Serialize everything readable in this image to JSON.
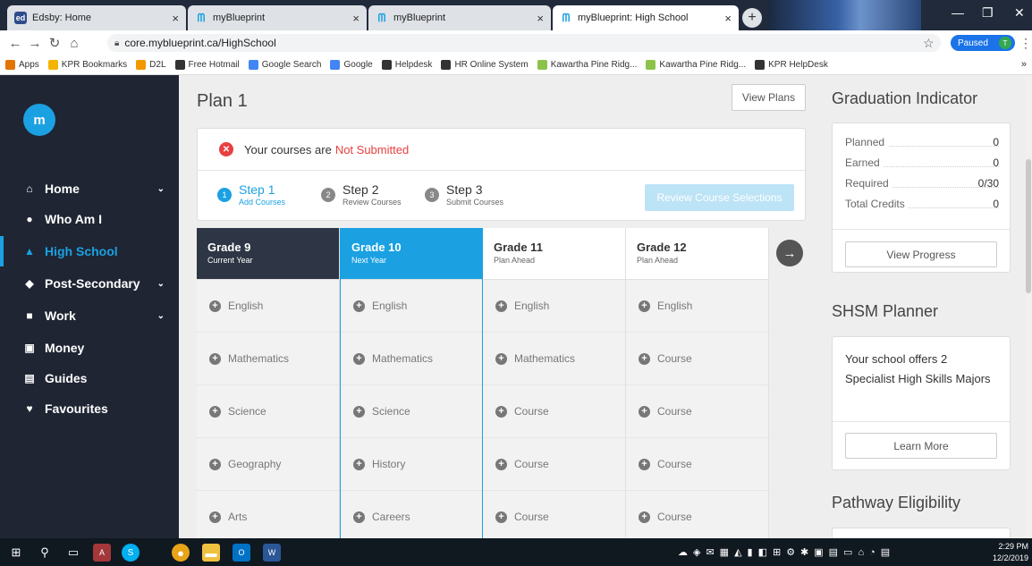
{
  "browser": {
    "tabs": [
      {
        "title": "Edsby: Home",
        "icon": "edsby-icon"
      },
      {
        "title": "myBlueprint",
        "icon": "myblueprint-icon"
      },
      {
        "title": "myBlueprint",
        "icon": "myblueprint-icon"
      },
      {
        "title": "myBlueprint: High School",
        "icon": "myblueprint-icon",
        "active": true
      }
    ],
    "url": "core.myblueprint.ca/HighSchool",
    "profile_status": "Paused",
    "profile_initial": "T",
    "bookmarks": [
      {
        "label": "Apps",
        "color": "#e37400"
      },
      {
        "label": "KPR Bookmarks",
        "color": "#f4b400"
      },
      {
        "label": "D2L",
        "color": "#f29900"
      },
      {
        "label": "Free Hotmail",
        "color": "#333333"
      },
      {
        "label": "Google Search",
        "color": "#4285f4"
      },
      {
        "label": "Google",
        "color": "#4285f4"
      },
      {
        "label": "Helpdesk",
        "color": "#333333"
      },
      {
        "label": "HR Online System",
        "color": "#333333"
      },
      {
        "label": "Kawartha Pine Ridg...",
        "color": "#8bc34a"
      },
      {
        "label": "Kawartha Pine Ridg...",
        "color": "#8bc34a"
      },
      {
        "label": "KPR HelpDesk",
        "color": "#333333"
      }
    ],
    "bookmarks_more": "»"
  },
  "sidebar": {
    "logo": "m",
    "items": [
      {
        "label": "Home",
        "icon": "home-icon",
        "glyph": "⌂",
        "caret": "⌄"
      },
      {
        "label": "Who Am I",
        "icon": "compass-icon",
        "glyph": "●",
        "caret": ""
      },
      {
        "label": "High School",
        "icon": "school-icon",
        "glyph": "▲",
        "caret": "",
        "active": true
      },
      {
        "label": "Post-Secondary",
        "icon": "graduation-cap-icon",
        "glyph": "◆",
        "caret": "⌄"
      },
      {
        "label": "Work",
        "icon": "briefcase-icon",
        "glyph": "■",
        "caret": "⌄"
      },
      {
        "label": "Money",
        "icon": "money-icon",
        "glyph": "▣",
        "caret": ""
      },
      {
        "label": "Guides",
        "icon": "guides-icon",
        "glyph": "▤",
        "caret": ""
      },
      {
        "label": "Favourites",
        "icon": "heart-icon",
        "glyph": "♥",
        "caret": ""
      }
    ]
  },
  "main": {
    "plan_title": "Plan 1",
    "view_plans_label": "View Plans",
    "status_prefix": "Your courses are",
    "status_value": "Not Submitted",
    "steps": [
      {
        "num": "1",
        "title": "Step 1",
        "sub": "Add Courses",
        "current": true
      },
      {
        "num": "2",
        "title": "Step 2",
        "sub": "Review Courses",
        "current": false
      },
      {
        "num": "3",
        "title": "Step 3",
        "sub": "Submit Courses",
        "current": false
      }
    ],
    "review_button": "Review Course Selections",
    "grades": [
      {
        "title": "Grade 9",
        "sub": "Current Year",
        "courses": [
          "English",
          "Mathematics",
          "Science",
          "Geography",
          "Arts"
        ]
      },
      {
        "title": "Grade 10",
        "sub": "Next Year",
        "courses": [
          "English",
          "Mathematics",
          "Science",
          "History",
          "Careers"
        ]
      },
      {
        "title": "Grade 11",
        "sub": "Plan Ahead",
        "courses": [
          "English",
          "Mathematics",
          "Course",
          "Course",
          "Course"
        ]
      },
      {
        "title": "Grade 12",
        "sub": "Plan Ahead",
        "courses": [
          "English",
          "Course",
          "Course",
          "Course",
          "Course"
        ]
      }
    ]
  },
  "right": {
    "graduation_title": "Graduation Indicator",
    "credits": [
      {
        "label": "Planned",
        "value": "0"
      },
      {
        "label": "Earned",
        "value": "0"
      },
      {
        "label": "Required",
        "value": "0/30"
      },
      {
        "label": "Total Credits",
        "value": "0"
      }
    ],
    "view_progress_label": "View Progress",
    "shsm_title": "SHSM Planner",
    "shsm_text": "Your school offers 2 Specialist High Skills Majors",
    "learn_more_label": "Learn More",
    "pathway_title": "Pathway Eligibility"
  },
  "taskbar": {
    "time": "2:29 PM",
    "date": "12/2/2019"
  }
}
